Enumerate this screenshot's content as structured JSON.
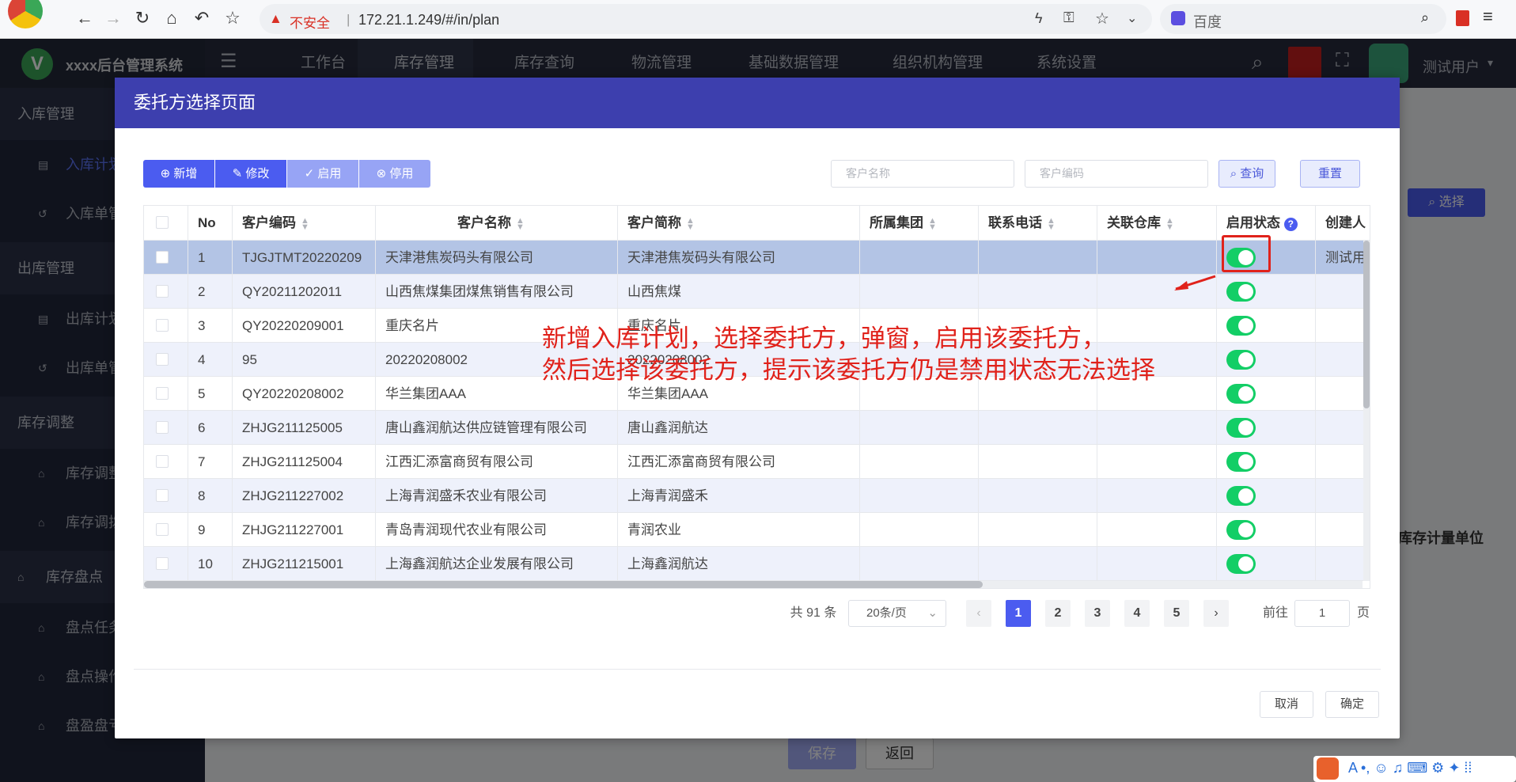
{
  "browser": {
    "insecure_label": "不安全",
    "url": "172.21.1.249/#/in/plan",
    "search_placeholder": "百度"
  },
  "app": {
    "title": "xxxx后台管理系统",
    "logo_letter": "V",
    "user": "测试用户",
    "nav": [
      "工作台",
      "库存管理",
      "库存查询",
      "物流管理",
      "基础数据管理",
      "组织机构管理",
      "系统设置"
    ]
  },
  "sidebar": {
    "groups": [
      "入库管理",
      "出库管理",
      "库存调整",
      "库存盘点"
    ],
    "items": [
      "入库计划",
      "入库单管",
      "出库计划",
      "出库单管",
      "库存调整",
      "库存调拨",
      "盘点任务",
      "盘点操作",
      "盘盈盘亏"
    ]
  },
  "background": {
    "select_btn": "选择",
    "col_unit": "库存计量单位",
    "save_btn": "保存",
    "back_btn": "返回"
  },
  "modal": {
    "title": "委托方选择页面",
    "toolbar": {
      "add": "新增",
      "edit": "修改",
      "enable": "启用",
      "disable": "停用"
    },
    "search": {
      "name_placeholder": "客户名称",
      "code_placeholder": "客户编码",
      "query": "查询",
      "reset": "重置"
    },
    "columns": [
      "No",
      "客户编码",
      "客户名称",
      "客户简称",
      "所属集团",
      "联系电话",
      "关联仓库",
      "启用状态",
      "创建人"
    ],
    "rows": [
      {
        "no": "1",
        "code": "TJGJTMT20220209",
        "name": "天津港焦炭码头有限公司",
        "short": "天津港焦炭码头有限公司",
        "creator": "测试用户",
        "enabled": true
      },
      {
        "no": "2",
        "code": "QY20211202011",
        "name": "山西焦煤集团煤焦销售有限公司",
        "short": "山西焦煤",
        "creator": "",
        "enabled": true
      },
      {
        "no": "3",
        "code": "QY20220209001",
        "name": "重庆名片",
        "short": "重庆名片",
        "creator": "",
        "enabled": true
      },
      {
        "no": "4",
        "code": "95",
        "name": "20220208002",
        "short": "20220208002",
        "creator": "",
        "enabled": true
      },
      {
        "no": "5",
        "code": "QY20220208002",
        "name": "华兰集团AAA",
        "short": "华兰集团AAA",
        "creator": "",
        "enabled": true
      },
      {
        "no": "6",
        "code": "ZHJG211125005",
        "name": "唐山鑫润航达供应链管理有限公司",
        "short": "唐山鑫润航达",
        "creator": "",
        "enabled": true
      },
      {
        "no": "7",
        "code": "ZHJG211125004",
        "name": "江西汇添富商贸有限公司",
        "short": "江西汇添富商贸有限公司",
        "creator": "",
        "enabled": true
      },
      {
        "no": "8",
        "code": "ZHJG211227002",
        "name": "上海青润盛禾农业有限公司",
        "short": "上海青润盛禾",
        "creator": "",
        "enabled": true
      },
      {
        "no": "9",
        "code": "ZHJG211227001",
        "name": "青岛青润现代农业有限公司",
        "short": "青润农业",
        "creator": "",
        "enabled": true
      },
      {
        "no": "10",
        "code": "ZHJG211215001",
        "name": "上海鑫润航达企业发展有限公司",
        "short": "上海鑫润航达",
        "creator": "",
        "enabled": true
      }
    ],
    "pagination": {
      "total": "共 91 条",
      "page_size": "20条/页",
      "pages": [
        "1",
        "2",
        "3",
        "4",
        "5"
      ],
      "current": "1",
      "goto_label": "前往",
      "goto_value": "1",
      "page_suffix": "页"
    },
    "footer": {
      "cancel": "取消",
      "confirm": "确定"
    }
  },
  "annotation": {
    "line1": "新增入库计划，选择委托方，弹窗，启用该委托方，",
    "line2": "然后选择该委托方，提示该委托方仍是禁用状态无法选择"
  },
  "colors": {
    "header_bg": "#3d3fae",
    "primary": "#4b5cf0",
    "toggle_on": "#13ce66",
    "annotation": "#e0221b"
  }
}
